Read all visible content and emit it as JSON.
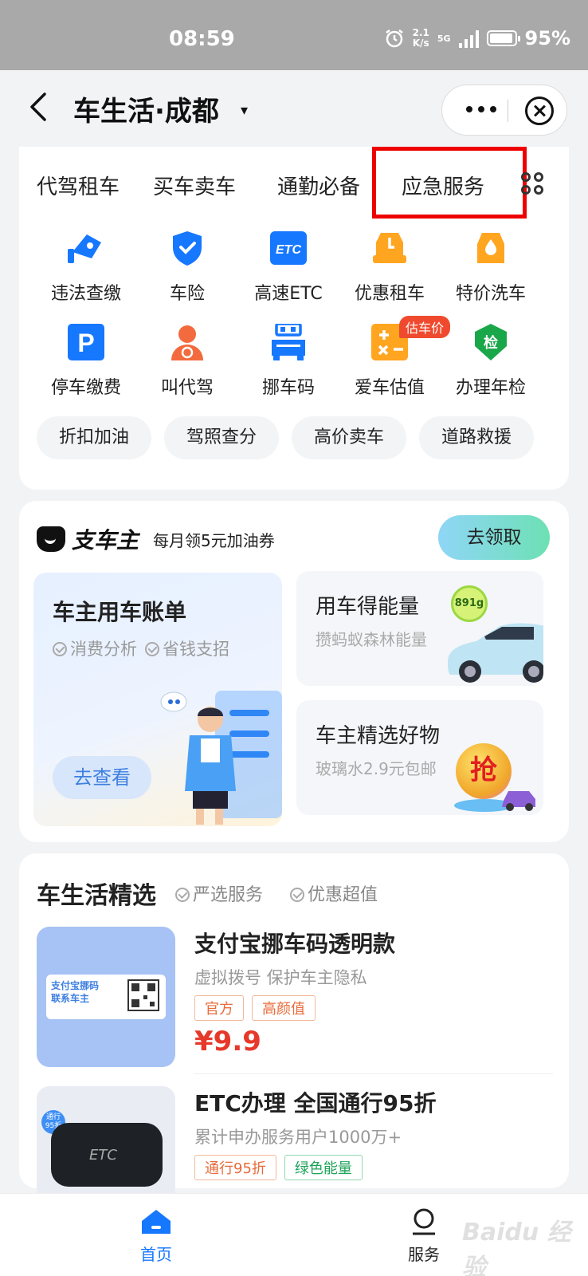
{
  "status_bar": {
    "time": "08:59",
    "speed_value": "2.1",
    "speed_unit": "K/s",
    "network": "5G",
    "battery": "95%",
    "battery_level": 0.95
  },
  "header": {
    "title": "车生活·成都",
    "caret": "▾"
  },
  "tabs": [
    "代驾租车",
    "买车卖车",
    "通勤必备",
    "应急服务"
  ],
  "grid_items": [
    {
      "label": "违法查缴",
      "icon": "camera-icon"
    },
    {
      "label": "车险",
      "icon": "shield-check-icon"
    },
    {
      "label": "高速ETC",
      "icon": "etc-icon"
    },
    {
      "label": "优惠租车",
      "icon": "car-key-icon"
    },
    {
      "label": "特价洗车",
      "icon": "car-wash-icon"
    },
    {
      "label": "停车缴费",
      "icon": "parking-icon"
    },
    {
      "label": "叫代驾",
      "icon": "driver-icon"
    },
    {
      "label": "挪车码",
      "icon": "qr-car-icon"
    },
    {
      "label": "爱车估值",
      "icon": "calculator-icon",
      "badge": "估车价"
    },
    {
      "label": "办理年检",
      "icon": "inspection-icon",
      "icon_text": "检"
    }
  ],
  "pills": [
    "折扣加油",
    "驾照查分",
    "高价卖车",
    "道路救援"
  ],
  "zhichezhu": {
    "logo": "支车主",
    "subtitle": "每月领5元加油券",
    "claim_button": "去领取",
    "bill": {
      "title": "车主用车账单",
      "tag1": "消费分析",
      "tag2": "省钱支招",
      "button": "去查看"
    },
    "energy": {
      "title": "用车得能量",
      "subtitle": "攒蚂蚁森林能量",
      "badge": "891g"
    },
    "goods": {
      "title": "车主精选好物",
      "subtitle": "玻璃水2.9元包邮",
      "badge": "抢"
    }
  },
  "selection": {
    "title": "车生活精选",
    "tag1": "严选服务",
    "tag2": "优惠超值",
    "products": [
      {
        "title": "支付宝挪车码透明款",
        "subtitle": "虚拟拨号 保护车主隐私",
        "tags": [
          "官方",
          "高颜值"
        ],
        "price": "¥9.9",
        "thumb_text": "支付宝挪码\n联系车主"
      },
      {
        "title": "ETC办理 全国通行95折",
        "subtitle": "累计申办服务用户1000万+",
        "tags": [
          "通行95折",
          "绿色能量"
        ],
        "price": "",
        "thumb_badge": "通行\n95折",
        "thumb_text": "ETC"
      }
    ]
  },
  "tabbar": {
    "home": "首页",
    "service": "服务"
  },
  "watermark": "Baidu 经验",
  "colors": {
    "primary": "#1677ff",
    "highlight": "#ee0000",
    "price": "#e6392a",
    "orange": "#ffa51f"
  }
}
